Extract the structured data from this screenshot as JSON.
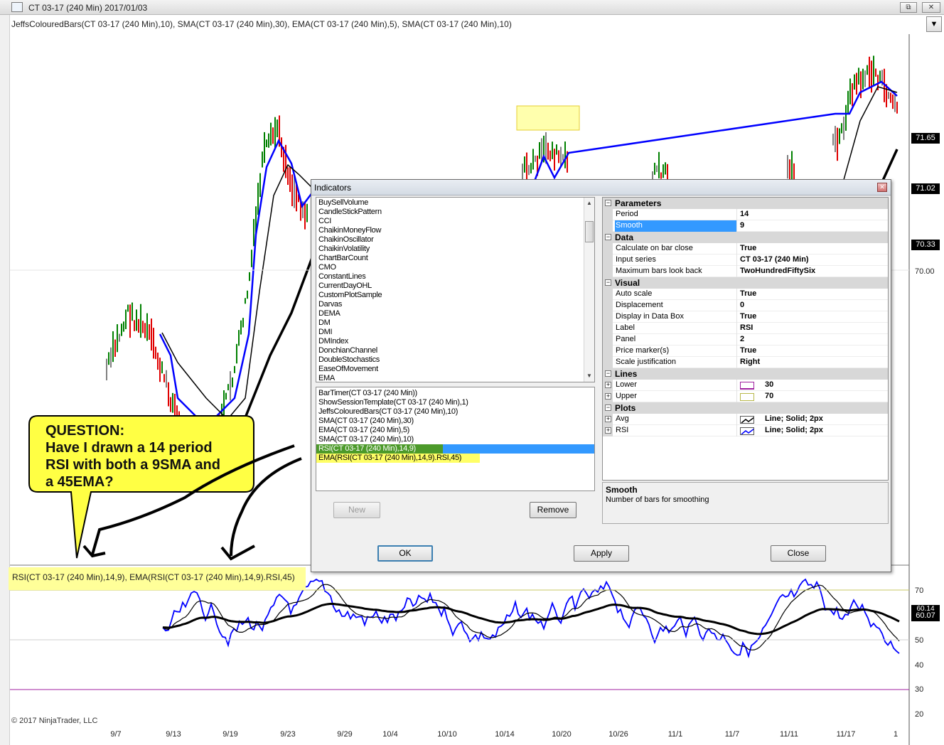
{
  "window": {
    "title": "CT 03-17 (240 Min)  2017/01/03",
    "restore_label": "⧉",
    "close_label": "✕"
  },
  "chart": {
    "overlay_label": "JeffsColouredBars(CT 03-17 (240 Min),10), SMA(CT 03-17 (240 Min),30), EMA(CT 03-17 (240 Min),5), SMA(CT 03-17 (240 Min),10)",
    "dropdown_label": "▼",
    "price_tags": [
      "71.65",
      "71.02",
      "70.33"
    ],
    "price_ticks": [
      "70.00"
    ],
    "rsi_label": "RSI(CT 03-17 (240 Min),14,9), EMA(RSI(CT 03-17 (240 Min),14,9).RSI,45)",
    "rsi_tags": [
      "60.14",
      "60.07"
    ],
    "rsi_ticks": [
      "70",
      "60",
      "50",
      "40",
      "30",
      "20"
    ],
    "dates": [
      "9/7",
      "9/13",
      "9/19",
      "9/23",
      "9/29",
      "10/4",
      "10/10",
      "10/14",
      "10/20",
      "10/26",
      "11/1",
      "11/7",
      "11/11",
      "11/17",
      "1"
    ],
    "copyright": "© 2017 NinjaTrader, LLC",
    "colors": {
      "up_bar": "#008000",
      "down_bar": "#e00000",
      "neutral_bar": "#808080",
      "ema_line": "#0000ff",
      "sma_line": "#000000",
      "upper_line": "#c8c864",
      "lower_line": "#a020a0",
      "highlight": "#ffff99"
    }
  },
  "callout": {
    "lines": [
      "QUESTION:",
      "Have I drawn a 14 period",
      "RSI with both a 9SMA and",
      "a 45EMA?"
    ]
  },
  "dialog": {
    "title": "Indicators",
    "close_label": "✕",
    "available": [
      "BuySellVolume",
      "CandleStickPattern",
      "CCI",
      "ChaikinMoneyFlow",
      "ChaikinOscillator",
      "ChaikinVolatility",
      "ChartBarCount",
      "CMO",
      "ConstantLines",
      "CurrentDayOHL",
      "CustomPlotSample",
      "Darvas",
      "DEMA",
      "DM",
      "DMI",
      "DMIndex",
      "DonchianChannel",
      "DoubleStochastics",
      "EaseOfMovement",
      "EMA"
    ],
    "applied": [
      "BarTimer(CT 03-17 (240 Min))",
      "ShowSessionTemplate(CT 03-17 (240 Min),1)",
      "JeffsColouredBars(CT 03-17 (240 Min),10)",
      "SMA(CT 03-17 (240 Min),30)",
      "EMA(CT 03-17 (240 Min),5)",
      "SMA(CT 03-17 (240 Min),10)",
      "RSI(CT 03-17 (240 Min),14,9)",
      "EMA(RSI(CT 03-17 (240 Min),14,9).RSI,45)"
    ],
    "buttons": {
      "new": "New",
      "remove": "Remove",
      "ok": "OK",
      "apply": "Apply",
      "close": "Close"
    },
    "properties": {
      "categories": {
        "parameters": "Parameters",
        "data": "Data",
        "visual": "Visual",
        "lines": "Lines",
        "plots": "Plots"
      },
      "period": {
        "name": "Period",
        "value": "14"
      },
      "smooth": {
        "name": "Smooth",
        "value": "9"
      },
      "calculate": {
        "name": "Calculate on bar close",
        "value": "True"
      },
      "input_series": {
        "name": "Input series",
        "value": "CT 03-17 (240 Min)"
      },
      "max_bars": {
        "name": "Maximum bars look back",
        "value": "TwoHundredFiftySix"
      },
      "auto_scale": {
        "name": "Auto scale",
        "value": "True"
      },
      "displacement": {
        "name": "Displacement",
        "value": "0"
      },
      "display_databox": {
        "name": "Display in Data Box",
        "value": "True"
      },
      "label": {
        "name": "Label",
        "value": "RSI"
      },
      "panel": {
        "name": "Panel",
        "value": "2"
      },
      "price_markers": {
        "name": "Price marker(s)",
        "value": "True"
      },
      "scale_justification": {
        "name": "Scale justification",
        "value": "Right"
      },
      "lower": {
        "name": "Lower",
        "value": "30"
      },
      "upper": {
        "name": "Upper",
        "value": "70"
      },
      "avg": {
        "name": "Avg",
        "value": "Line; Solid; 2px"
      },
      "rsi": {
        "name": "RSI",
        "value": "Line; Solid; 2px"
      }
    },
    "description": {
      "title": "Smooth",
      "text": "Number of bars for smoothing"
    }
  }
}
